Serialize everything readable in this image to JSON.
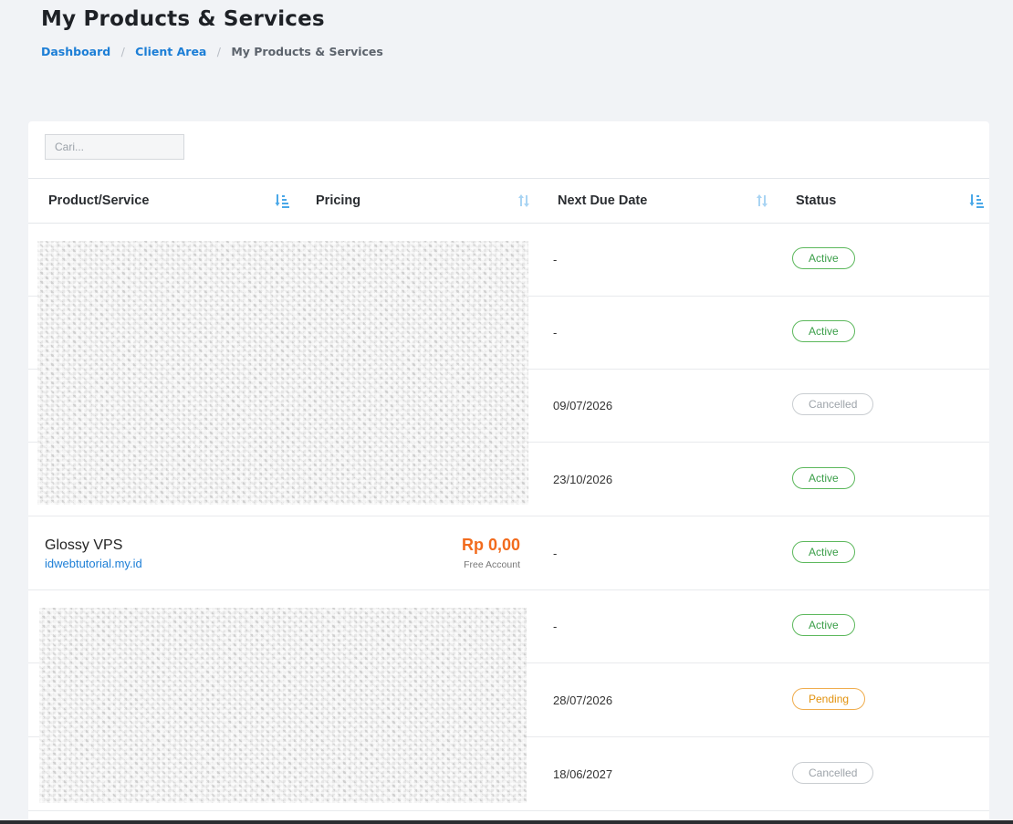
{
  "page": {
    "title": "My Products & Services"
  },
  "breadcrumb": {
    "items": [
      "Dashboard",
      "Client Area"
    ],
    "current": "My Products & Services"
  },
  "search": {
    "placeholder": "Cari...",
    "value": ""
  },
  "table": {
    "columns": {
      "product": "Product/Service",
      "pricing": "Pricing",
      "due": "Next Due Date",
      "status": "Status"
    },
    "rows": [
      {
        "due": "-",
        "status": "Active",
        "status_type": "active"
      },
      {
        "due": "-",
        "status": "Active",
        "status_type": "active"
      },
      {
        "due": "09/07/2026",
        "status": "Cancelled",
        "status_type": "cancelled"
      },
      {
        "due": "23/10/2026",
        "status": "Active",
        "status_type": "active"
      },
      {
        "product": "Glossy VPS",
        "domain": "idwebtutorial.my.id",
        "price": "Rp 0,00",
        "cycle": "Free Account",
        "due": "-",
        "status": "Active",
        "status_type": "active"
      },
      {
        "due": "-",
        "status": "Active",
        "status_type": "active"
      },
      {
        "due": "28/07/2026",
        "status": "Pending",
        "status_type": "pending"
      },
      {
        "due": "18/06/2027",
        "status": "Cancelled",
        "status_type": "cancelled"
      }
    ]
  },
  "colors": {
    "link": "#1c7ed6",
    "price": "#f26b1d",
    "active": "#5cb85c",
    "pending": "#f0ad4e",
    "cancelled": "#c9cdd1"
  },
  "icons": {
    "sort_asc": "sort-amount-icon",
    "sort_both": "sort-both-icon"
  }
}
